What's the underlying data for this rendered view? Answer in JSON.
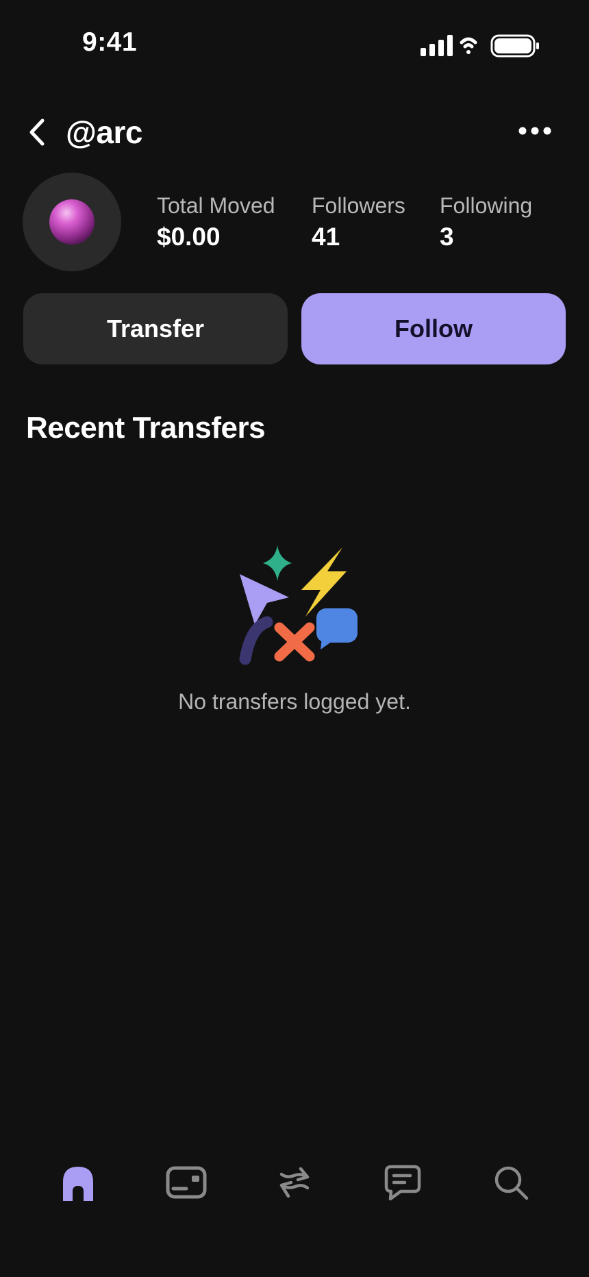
{
  "status_bar": {
    "time": "9:41"
  },
  "header": {
    "handle": "@arc",
    "back_icon": "chevron-left-icon",
    "more_icon": "ellipsis-icon"
  },
  "profile": {
    "avatar_icon": "purple-sphere-avatar",
    "stats": [
      {
        "label": "Total Moved",
        "value": "$0.00"
      },
      {
        "label": "Followers",
        "value": "41"
      },
      {
        "label": "Following",
        "value": "3"
      }
    ]
  },
  "actions": {
    "transfer_label": "Transfer",
    "follow_label": "Follow"
  },
  "recent": {
    "title": "Recent Transfers",
    "empty_message": "No transfers logged yet."
  },
  "tab_bar": {
    "items": [
      {
        "name": "home",
        "icon": "home-icon",
        "active": true
      },
      {
        "name": "card",
        "icon": "card-icon",
        "active": false
      },
      {
        "name": "transfer",
        "icon": "transfer-arrows-icon",
        "active": false
      },
      {
        "name": "messages",
        "icon": "chat-icon",
        "active": false
      },
      {
        "name": "search",
        "icon": "search-icon",
        "active": false
      }
    ]
  },
  "colors": {
    "background": "#111111",
    "accent": "#a99df4",
    "button_dark": "#2b2b2b",
    "inactive_icon": "#8a8a8a"
  }
}
